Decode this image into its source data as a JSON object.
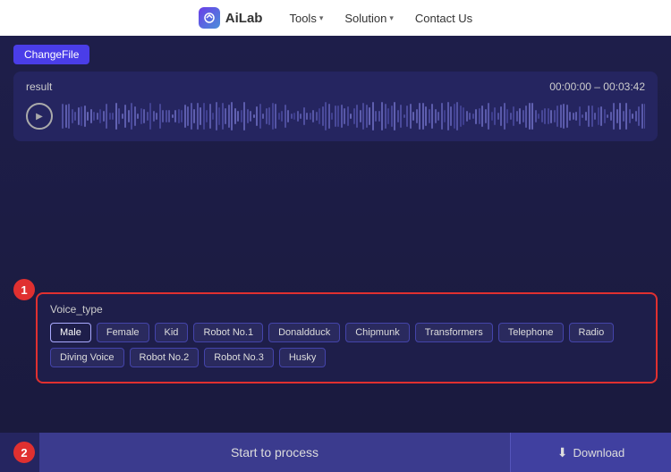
{
  "header": {
    "logo_text": "AiLab",
    "nav_items": [
      {
        "label": "Tools",
        "has_dropdown": true
      },
      {
        "label": "Solution",
        "has_dropdown": true
      },
      {
        "label": "Contact Us",
        "has_dropdown": false
      }
    ]
  },
  "player": {
    "label": "result",
    "timestamp": "00:00:00 – 00:03:42"
  },
  "voice_type": {
    "section_label": "Voice_type",
    "buttons_row1": [
      {
        "label": "Male",
        "active": true
      },
      {
        "label": "Female",
        "active": false
      },
      {
        "label": "Kid",
        "active": false
      },
      {
        "label": "Robot No.1",
        "active": false
      },
      {
        "label": "Donaldduck",
        "active": false
      },
      {
        "label": "Chipmunk",
        "active": false
      },
      {
        "label": "Transformers",
        "active": false
      },
      {
        "label": "Telephone",
        "active": false
      },
      {
        "label": "Radio",
        "active": false
      }
    ],
    "buttons_row2": [
      {
        "label": "Diving Voice",
        "active": false
      },
      {
        "label": "Robot No.2",
        "active": false
      },
      {
        "label": "Robot No.3",
        "active": false
      },
      {
        "label": "Husky",
        "active": false
      }
    ]
  },
  "step1_label": "1",
  "step2_label": "2",
  "change_file_label": "ChangeFile",
  "start_button_label": "Start to process",
  "download_button_label": "Download"
}
